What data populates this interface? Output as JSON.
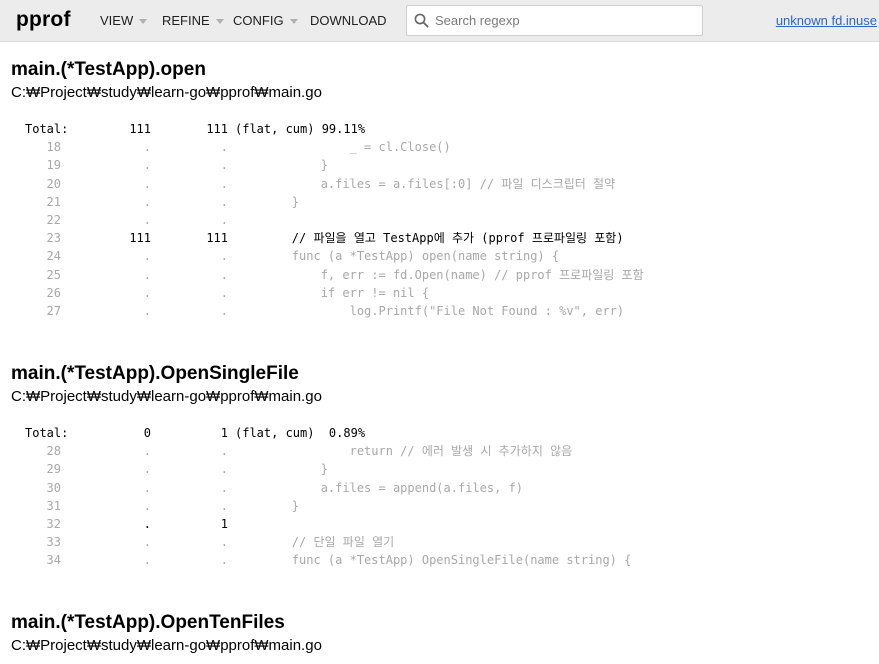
{
  "header": {
    "brand": "pprof",
    "menus": [
      {
        "label": "VIEW",
        "has_caret": true
      },
      {
        "label": "REFINE",
        "has_caret": true
      },
      {
        "label": "CONFIG",
        "has_caret": true
      },
      {
        "label": "DOWNLOAD",
        "has_caret": false
      }
    ],
    "search_placeholder": "Search regexp",
    "status_link": "unknown fd.inuse"
  },
  "sections": [
    {
      "func": "main.(*TestApp).open",
      "path": "C:₩Project₩study₩learn-go₩pprof₩main.go",
      "total": {
        "label": "Total:",
        "flat": "111",
        "cum": "111",
        "rest": "(flat, cum) 99.11%"
      },
      "lines": [
        {
          "ln": "18",
          "flat": ".",
          "cum": ".",
          "src": "                _ = cl.Close()",
          "hot": false
        },
        {
          "ln": "19",
          "flat": ".",
          "cum": ".",
          "src": "            }",
          "hot": false
        },
        {
          "ln": "20",
          "flat": ".",
          "cum": ".",
          "src": "            a.files = a.files[:0] // 파일 디스크립터 절약",
          "hot": false
        },
        {
          "ln": "21",
          "flat": ".",
          "cum": ".",
          "src": "        }",
          "hot": false
        },
        {
          "ln": "22",
          "flat": ".",
          "cum": ".",
          "src": "",
          "hot": false
        },
        {
          "ln": "23",
          "flat": "111",
          "cum": "111",
          "src": "        // 파일을 열고 TestApp에 추가 (pprof 프로파일링 포함)",
          "hot": true
        },
        {
          "ln": "24",
          "flat": ".",
          "cum": ".",
          "src": "        func (a *TestApp) open(name string) {",
          "hot": false
        },
        {
          "ln": "25",
          "flat": ".",
          "cum": ".",
          "src": "            f, err := fd.Open(name) // pprof 프로파일링 포함",
          "hot": false
        },
        {
          "ln": "26",
          "flat": ".",
          "cum": ".",
          "src": "            if err != nil {",
          "hot": false
        },
        {
          "ln": "27",
          "flat": ".",
          "cum": ".",
          "src": "                log.Printf(\"File Not Found : %v\", err)",
          "hot": false
        }
      ]
    },
    {
      "func": "main.(*TestApp).OpenSingleFile",
      "path": "C:₩Project₩study₩learn-go₩pprof₩main.go",
      "total": {
        "label": "Total:",
        "flat": "0",
        "cum": "1",
        "rest": "(flat, cum)  0.89%"
      },
      "lines": [
        {
          "ln": "28",
          "flat": ".",
          "cum": ".",
          "src": "                return // 에러 발생 시 추가하지 않음",
          "hot": false
        },
        {
          "ln": "29",
          "flat": ".",
          "cum": ".",
          "src": "            }",
          "hot": false
        },
        {
          "ln": "30",
          "flat": ".",
          "cum": ".",
          "src": "            a.files = append(a.files, f)",
          "hot": false
        },
        {
          "ln": "31",
          "flat": ".",
          "cum": ".",
          "src": "        }",
          "hot": false
        },
        {
          "ln": "32",
          "flat": ".",
          "cum": "1",
          "src": "",
          "hot": true
        },
        {
          "ln": "33",
          "flat": ".",
          "cum": ".",
          "src": "        // 단일 파일 열기",
          "hot": false
        },
        {
          "ln": "34",
          "flat": ".",
          "cum": ".",
          "src": "        func (a *TestApp) OpenSingleFile(name string) {",
          "hot": false
        }
      ]
    },
    {
      "func": "main.(*TestApp).OpenTenFiles",
      "path": "C:₩Project₩study₩learn-go₩pprof₩main.go",
      "total": null,
      "lines": []
    }
  ]
}
